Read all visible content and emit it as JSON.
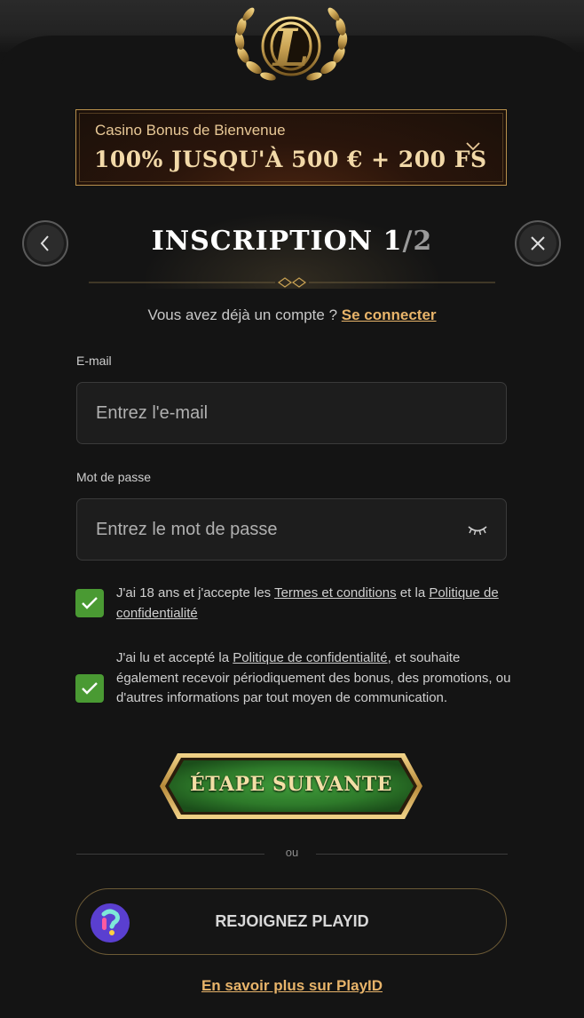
{
  "brand": {
    "logo_letter": "L",
    "gold": "#c9a253"
  },
  "bonus": {
    "label": "Casino Bonus de Bienvenue",
    "amount": "100% JUSQU'À 500 € + 200 FS",
    "icon": "chevron-down-icon"
  },
  "header": {
    "title_main": "INSCRIPTION 1",
    "title_total": "/2",
    "back_icon": "chevron-left-icon",
    "close_icon": "close-icon"
  },
  "login": {
    "prompt": "Vous avez déjà un compte ? ",
    "link": "Se connecter"
  },
  "form": {
    "email_label": "E-mail",
    "email_placeholder": "Entrez l'e-mail",
    "password_label": "Mot de passe",
    "password_placeholder": "Entrez le mot de passe",
    "password_icon": "eye-closed-icon"
  },
  "consents": {
    "age": {
      "checked": true,
      "text_1": "J'ai 18 ans et j'accepte les ",
      "link_terms": "Termes et conditions",
      "text_2": " et la ",
      "link_privacy": "Politique de confidentialité"
    },
    "marketing": {
      "checked": true,
      "text_1": "J'ai lu et accepté la ",
      "link_privacy": "Politique de confidentialité",
      "text_2": ", et souhaite également recevoir périodiquement des bonus, des promotions, ou d'autres informations par tout moyen de communication."
    }
  },
  "actions": {
    "next_label": "ÉTAPE SUIVANTE",
    "next_color": "#2e7a2a",
    "or_text": "ou",
    "playid_label": "REJOIGNEZ PLAYID",
    "learn_more": "En savoir plus sur PlayID"
  },
  "colors": {
    "accent": "#e8b46a",
    "check_green": "#4a9a33",
    "background": "#141414"
  }
}
